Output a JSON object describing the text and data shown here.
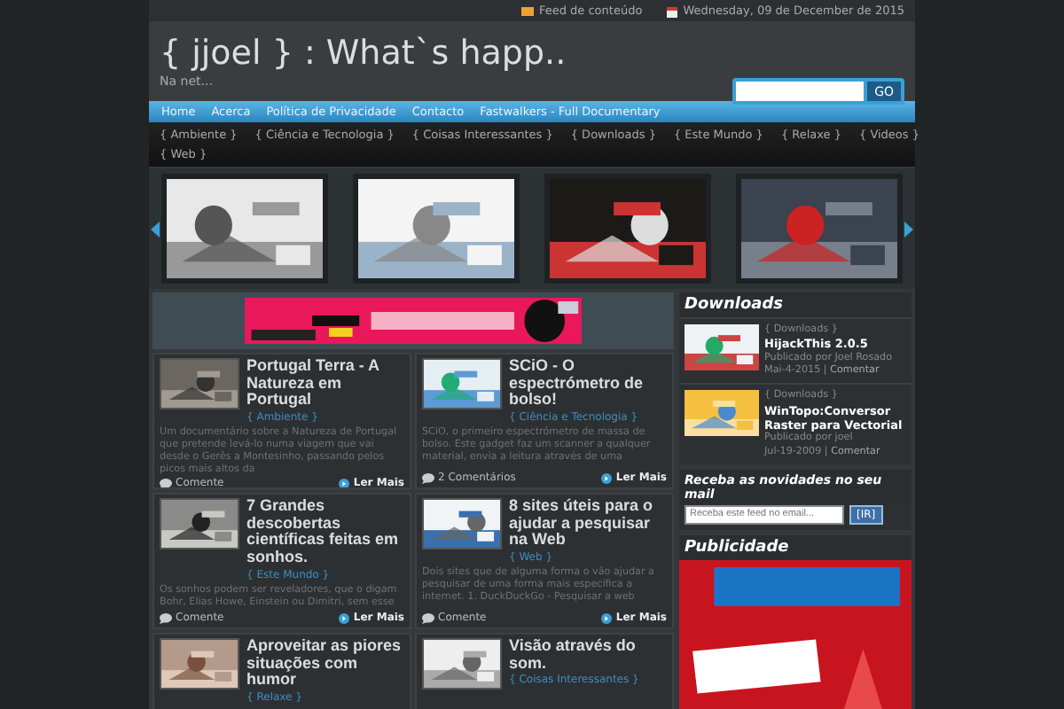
{
  "top_bar": {
    "feed": "Feed de conteúdo",
    "date": "Wednesday, 09 de December de 2015"
  },
  "header": {
    "title": "{ jjoel } : What`s happ..",
    "tagline": "Na net...",
    "search_button": "GO"
  },
  "nav": [
    "Home",
    "Acerca",
    "Política de Privacidade",
    "Contacto",
    "Fastwalkers - Full Documentary"
  ],
  "category_rows": [
    {
      "items": [
        "{ Ambiente }",
        "{ Ciência e Tecnologia }",
        "{ Coisas Interessantes }",
        "{ Downloads }",
        "{ Este Mundo }",
        "{ Relaxe }",
        "{ Videos }"
      ]
    },
    {
      "items": [
        "{ Web }"
      ]
    }
  ],
  "slider": [
    {
      "kind": "picture"
    },
    {
      "kind": "picture"
    },
    {
      "kind": "picture"
    },
    {
      "kind": "picture"
    }
  ],
  "posts": [
    {
      "title": "Portugal Terra - A Natureza em Portugal",
      "category": "{ Ambiente }",
      "excerpt": "Um documentário sobre a Natureza de Portugal que pretende levá-lo numa viagem que vai desde o Gerês a Montesinho, passando pelos picos mais altos da",
      "comments": "Comente",
      "more": "Ler Mais"
    },
    {
      "title": "SCiO - O espectrómetro de bolso!",
      "category": "{ Ciência e Tecnologia }",
      "excerpt": "SCiO, o primeiro espectrómetro de massa de bolso. Este gadget faz um scanner a qualquer material, envia a leitura através de uma",
      "comments": "2 Comentários",
      "more": "Ler Mais"
    },
    {
      "title": "7 Grandes descobertas científicas feitas em sonhos.",
      "category": "{ Este Mundo }",
      "excerpt": "Os sonhos podem ser reveladores, que o digam Bohr, Elias Howe, Einstein ou Dimitri, sem esse",
      "comments": "Comente",
      "more": "Ler Mais"
    },
    {
      "title": "8 sites úteis para o ajudar a pesquisar na Web",
      "category": "{ Web }",
      "excerpt": "Dois sites que de alguma forma o vão ajudar a pesquisar de uma forma mais específica a internet. 1. DuckDuckGo - Pesquisar a web",
      "comments": "Comente",
      "more": "Ler Mais"
    },
    {
      "title": "Aproveitar as piores situações com humor",
      "category": "{ Relaxe }"
    },
    {
      "title": "Visão através do som.",
      "category": "{ Coisas Interessantes }"
    }
  ],
  "downloads": {
    "title": "Downloads",
    "items": [
      {
        "category": "{ Downloads }",
        "title": "HijackThis 2.0.5",
        "author": "Publicado por Joel Rosado",
        "date": "Mai-4-2015",
        "separator": "|",
        "link": "Comentar"
      },
      {
        "category": "{ Downloads }",
        "title": "WinTopo:Conversor Raster para Vectorial",
        "author": "Publicado por joel",
        "date": "Jul-19-2009",
        "separator": "|",
        "link": "Comentar"
      }
    ]
  },
  "newsletter": {
    "title": "Receba as novidades no seu mail",
    "placeholder": "Receba este feed no email...",
    "button": "[IR]"
  },
  "ads": {
    "title": "Publicidade"
  }
}
